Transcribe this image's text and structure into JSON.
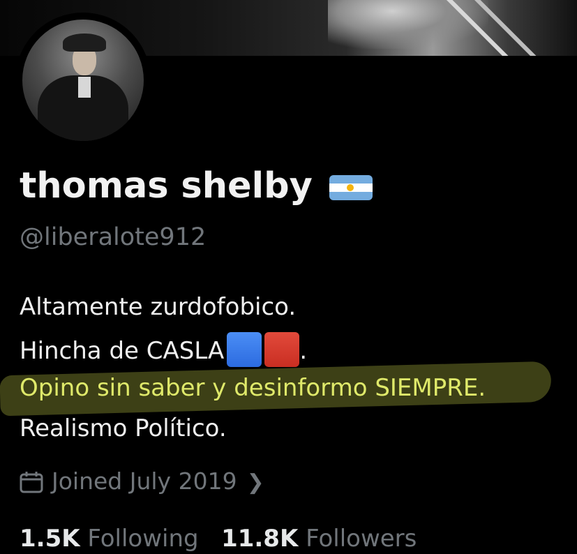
{
  "profile": {
    "display_name": "thomas shelby",
    "name_flag_icon": "argentina-flag-icon",
    "handle": "@liberalote912",
    "bio": {
      "line1": "Altamente zurdofobico.",
      "line2_text": "Hincha de CASLA",
      "line2_end": ".",
      "line2_icons": [
        "blue-square-icon",
        "red-square-icon"
      ],
      "line3": "Opino sin saber y desinformo SIEMPRE.",
      "line4": "Realismo Político."
    },
    "joined": "Joined July 2019",
    "joined_icon": "calendar-icon",
    "following_count": "1.5K",
    "following_label": "Following",
    "followers_count": "11.8K",
    "followers_label": "Followers"
  },
  "colors": {
    "background": "#000000",
    "primary_text": "#e7e9ea",
    "secondary_text": "#71767b",
    "highlight": "#dfe96a"
  }
}
